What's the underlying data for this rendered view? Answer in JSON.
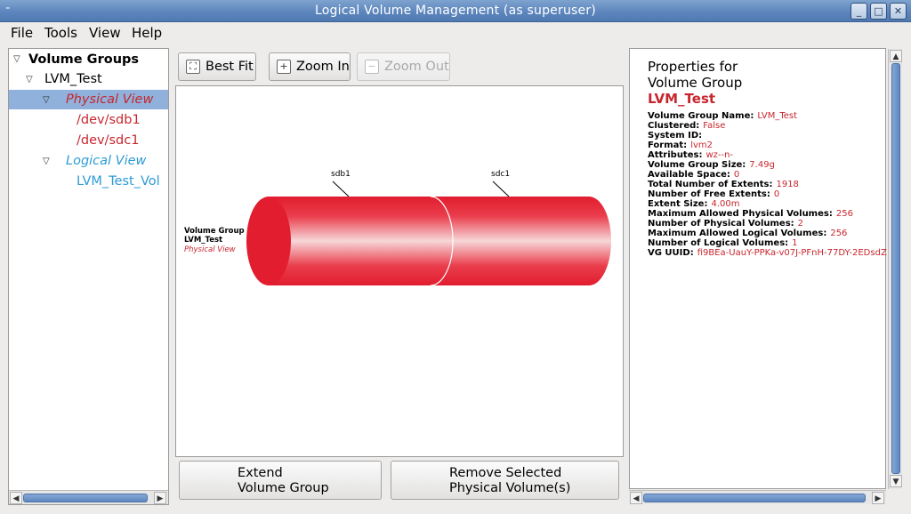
{
  "window": {
    "title": "Logical Volume Management (as superuser)",
    "menu_glyph": "⁼",
    "min_glyph": "_",
    "max_glyph": "□",
    "close_glyph": "✕"
  },
  "menubar": {
    "items": [
      "File",
      "Tools",
      "View",
      "Help"
    ]
  },
  "tree": {
    "root": "Volume Groups",
    "group": "LVM_Test",
    "physical_view": "Physical View",
    "pv1": "/dev/sdb1",
    "pv2": "/dev/sdc1",
    "logical_view": "Logical View",
    "lv1": "LVM_Test_Vol"
  },
  "toolbar": {
    "best_fit": "Best Fit",
    "zoom_in": "Zoom In",
    "zoom_out": "Zoom Out"
  },
  "diagram": {
    "label_line1": "Volume Group",
    "label_line2": "LVM_Test",
    "label_line3": "Physical View",
    "segment1_label": "sdb1",
    "segment2_label": "sdc1"
  },
  "buttons": {
    "extend_l1": "Extend",
    "extend_l2": "Volume Group",
    "remove_l1": "Remove Selected",
    "remove_l2": "Physical Volume(s)"
  },
  "properties": {
    "heading1": "Properties for",
    "heading2": "Volume Group",
    "name": "LVM_Test",
    "rows": [
      {
        "k": "Volume Group Name:",
        "v": "LVM_Test"
      },
      {
        "k": "Clustered:",
        "v": "False"
      },
      {
        "k": "System ID:",
        "v": ""
      },
      {
        "k": "Format:",
        "v": "lvm2"
      },
      {
        "k": "Attributes:",
        "v": "wz--n-"
      },
      {
        "k": "Volume Group Size:",
        "v": "7.49g"
      },
      {
        "k": "Available Space:",
        "v": "0"
      },
      {
        "k": "Total Number of Extents:",
        "v": "1918"
      },
      {
        "k": "Number of Free Extents:",
        "v": "0"
      },
      {
        "k": "Extent Size:",
        "v": "4.00m"
      },
      {
        "k": "Maximum Allowed Physical Volumes:",
        "v": "256"
      },
      {
        "k": "Number of Physical Volumes:",
        "v": "2"
      },
      {
        "k": "Maximum Allowed Logical Volumes:",
        "v": "256"
      },
      {
        "k": "Number of Logical Volumes:",
        "v": "1"
      },
      {
        "k": "VG UUID:",
        "v": "fi9BEa-UauY-PPKa-v07J-PFnH-77DY-2EDsdZ"
      }
    ]
  },
  "colors": {
    "accent_red": "#c8262e",
    "selection": "#8fb1dc",
    "logical_blue": "#2e9bd6"
  }
}
